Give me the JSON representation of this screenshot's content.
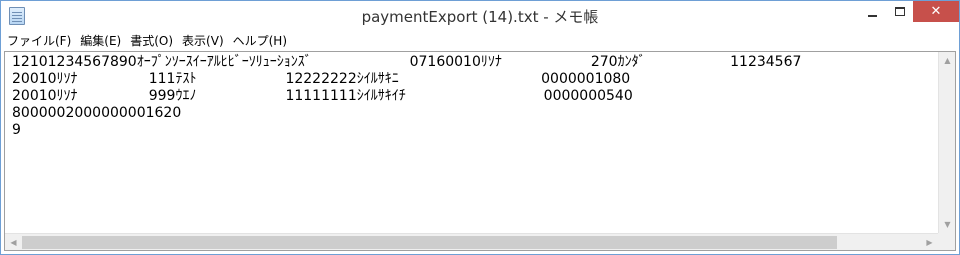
{
  "window": {
    "title": "paymentExport (14).txt - メモ帳",
    "icon": "notepad-icon",
    "controls": {
      "minimize_icon": "minimize-icon",
      "maximize_icon": "maximize-icon",
      "close_glyph": "✕"
    }
  },
  "menu": {
    "items": [
      {
        "label": "ファイル(F)"
      },
      {
        "label": "編集(E)"
      },
      {
        "label": "書式(O)"
      },
      {
        "label": "表示(V)"
      },
      {
        "label": "ヘルプ(H)"
      }
    ]
  },
  "editor": {
    "lines": [
      "12101234567890ｵｰﾌﾟﾝｿｰｽｲｰｱﾙﾋﾋﾞｰｿﾘｭｰｼｮﾝｽﾞ                      07160010ﾘｿﾅ                    270ｶﾝﾀﾞ                   11234567",
      "20010ﾘｿﾅ                111ﾃｽﾄ                    12222222ｼｲﾙｻｷﾆ                                0000001080",
      "20010ﾘｿﾅ                999ｳｴﾉ                    11111111ｼｲﾙｻｷｲﾁ                               0000000540",
      "8000002000000001620",
      "9"
    ]
  },
  "scrollbars": {
    "up_arrow": "▲",
    "down_arrow": "▼",
    "left_arrow": "◀",
    "right_arrow": "▶"
  }
}
